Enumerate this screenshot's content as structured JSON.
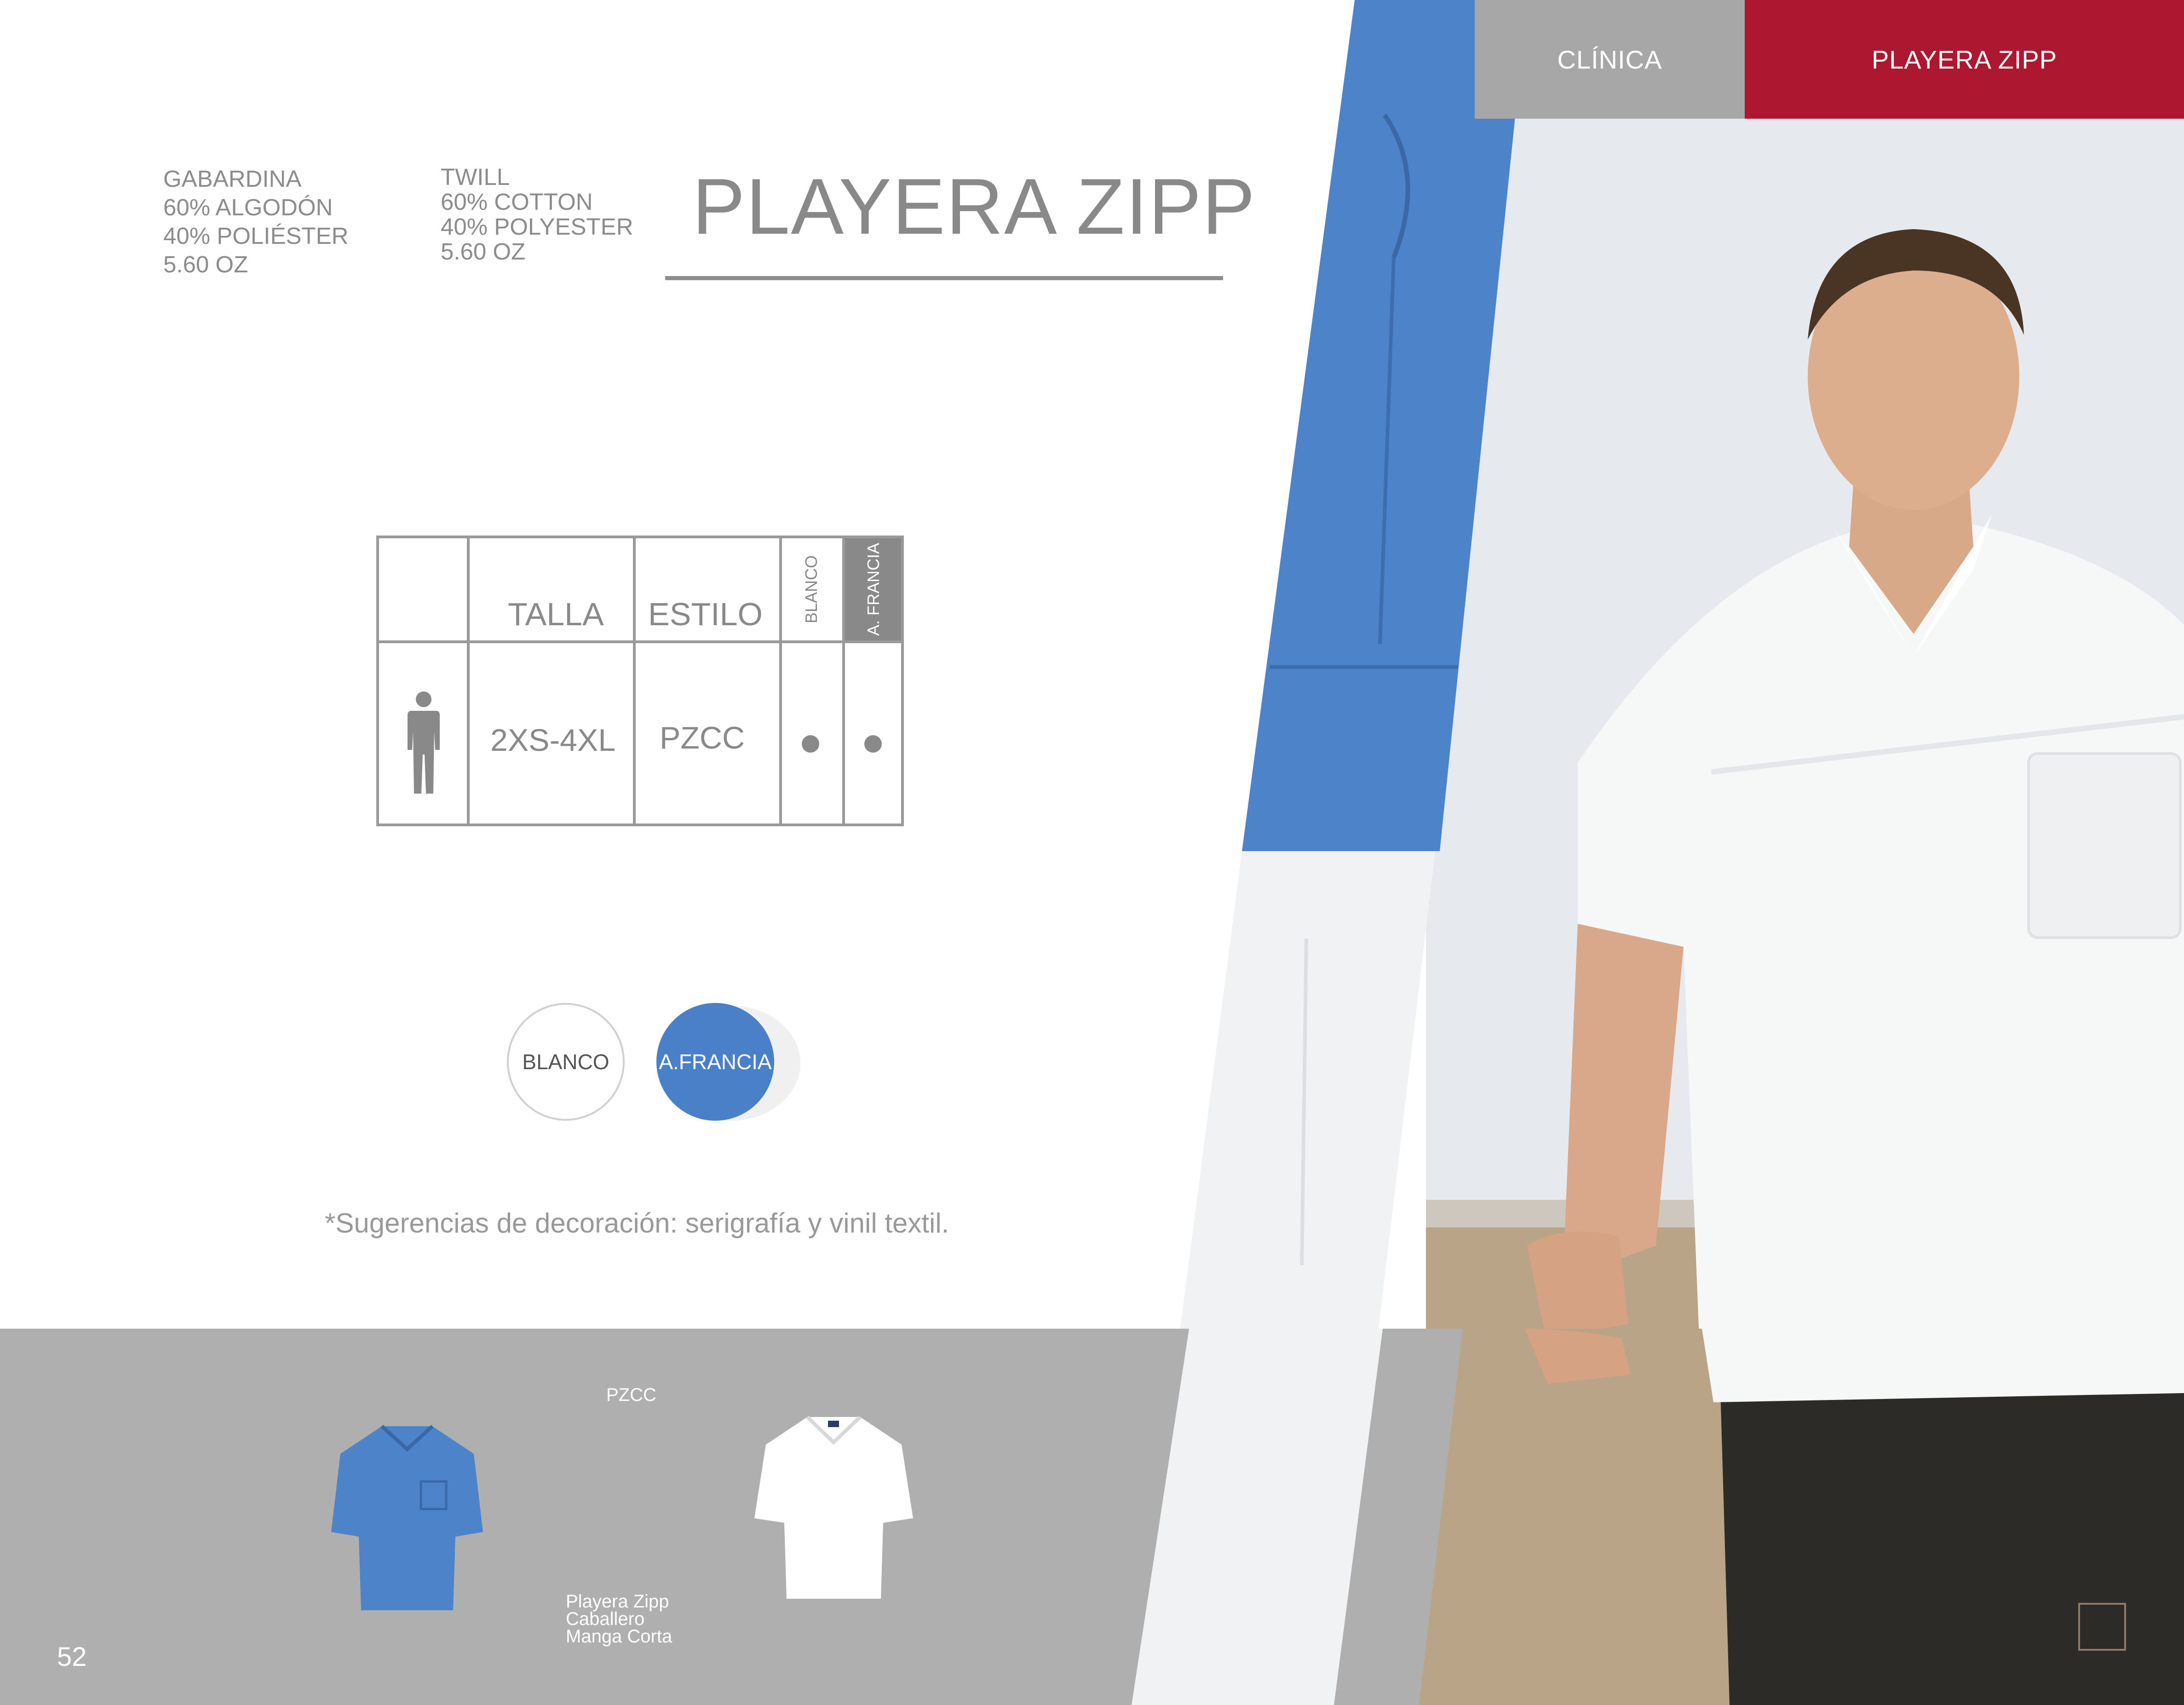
{
  "header": {
    "section_tab": "CLÍNICA",
    "product_tab": "PLAYERA ZIPP"
  },
  "fabrics": [
    {
      "lines": [
        "GABARDINA",
        "60% ALGODÓN",
        "40% POLIÉSTER",
        "5.60 OZ"
      ]
    },
    {
      "lines": [
        "TWILL",
        "60% COTTON",
        "40% POLYESTER",
        "5.60 OZ"
      ]
    }
  ],
  "title": "PLAYERA ZIPP",
  "table": {
    "headers": {
      "size": "TALLA",
      "style": "ESTILO",
      "color1": "BLANCO",
      "color2": "A. FRANCIA"
    },
    "row": {
      "size": "2XS-4XL",
      "style": "PZCC",
      "color1": "●",
      "color2": "●"
    },
    "icon": "man-icon"
  },
  "swatches": [
    {
      "label": "BLANCO",
      "color": "#ffffff",
      "text_color": "#555555"
    },
    {
      "label": "A.FRANCIA",
      "color": "#4a80c8",
      "text_color": "#ffffff"
    }
  ],
  "note": "*Sugerencias de decoración: serigrafía y vinil textil.",
  "products": {
    "code": "PZCC",
    "caption": [
      "Playera Zipp",
      "Caballero",
      "Manga Corta"
    ]
  },
  "page_number": "52",
  "colors": {
    "accent_red": "#ad1730",
    "tab_gray": "#a8a7a7",
    "band_gray": "#b0afaf",
    "blue": "#4a80c8"
  }
}
